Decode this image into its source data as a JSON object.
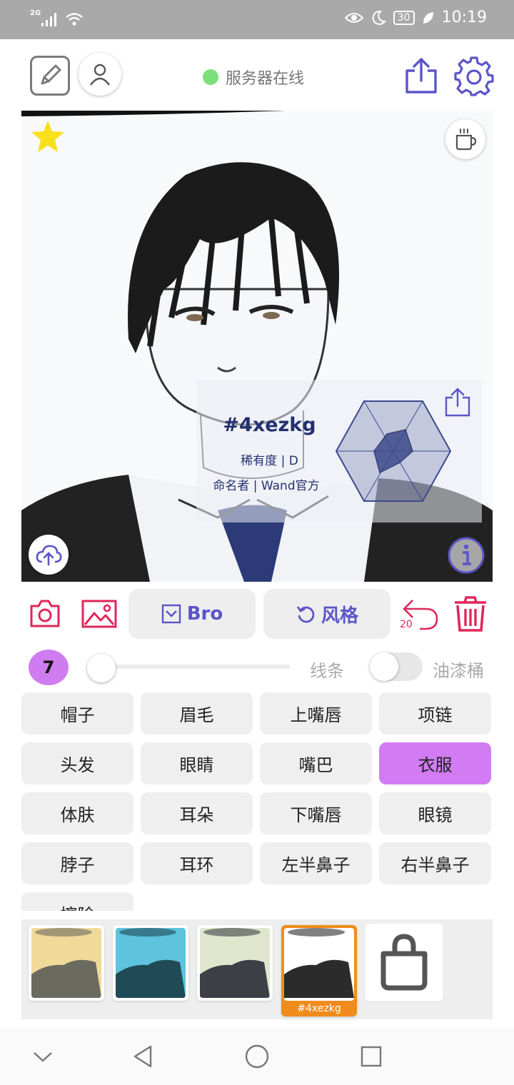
{
  "status_bar": {
    "network_type": "2G",
    "battery": "30",
    "time": "10:19"
  },
  "header": {
    "server_status": "服务器在线"
  },
  "character": {
    "id": "#4xezkg",
    "rarity": "稀有度 | D",
    "namer": "命名者 | Wand官方"
  },
  "toolbar": {
    "bro_label": "Bro",
    "style_label": "风格",
    "undo_count": "20"
  },
  "brush": {
    "size": "7",
    "line_label": "线条",
    "bucket_label": "油漆桶"
  },
  "parts": [
    {
      "label": "帽子"
    },
    {
      "label": "眉毛"
    },
    {
      "label": "上嘴唇"
    },
    {
      "label": "项链"
    },
    {
      "label": "头发"
    },
    {
      "label": "眼睛"
    },
    {
      "label": "嘴巴"
    },
    {
      "label": "衣服"
    },
    {
      "label": "体肤"
    },
    {
      "label": "耳朵"
    },
    {
      "label": "下嘴唇"
    },
    {
      "label": "眼镜"
    },
    {
      "label": "脖子"
    },
    {
      "label": "耳环"
    },
    {
      "label": "左半鼻子"
    },
    {
      "label": "右半鼻子"
    },
    {
      "label": "擦除"
    }
  ],
  "selected_part": "衣服",
  "thumbnails": [
    {
      "bg": "#f1d99a",
      "fg": "#6b6a5f"
    },
    {
      "bg": "#5ec3dc",
      "fg": "#1f4a56"
    },
    {
      "bg": "#dfe6cd",
      "fg": "#3c3f45"
    },
    {
      "bg": "#ffffff",
      "fg": "#2b2b2b",
      "label": "#4xezkg"
    }
  ],
  "colors": {
    "accent": "#5c55c8",
    "danger": "#e0275a",
    "selected": "#d17cf2",
    "online": "#7be07b",
    "orange": "#f08c1c"
  }
}
